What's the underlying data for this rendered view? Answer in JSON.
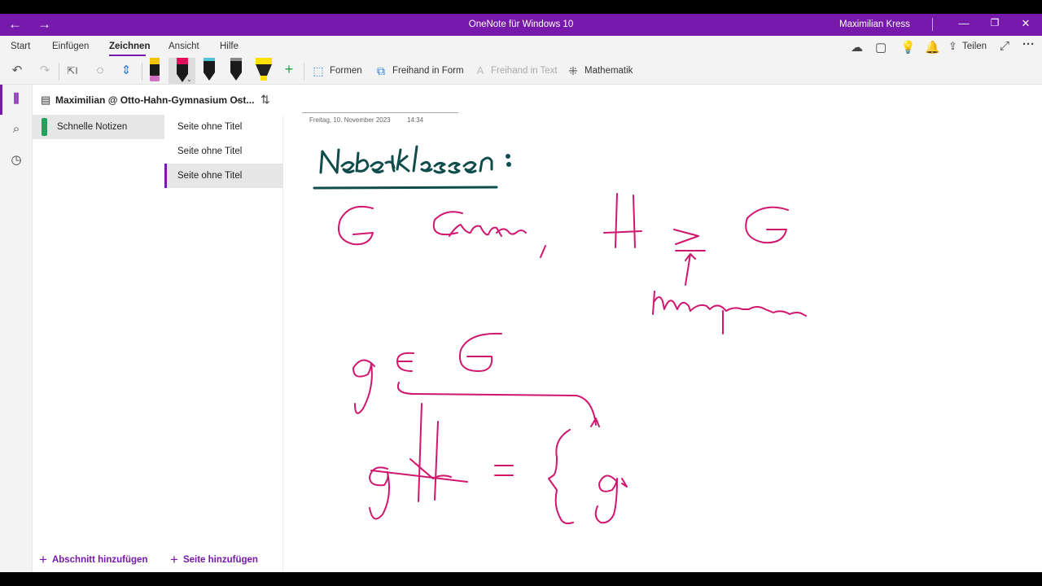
{
  "titlebar": {
    "app_title": "OneNote für Windows 10",
    "user": "Maximilian Kress"
  },
  "menu": {
    "tabs": [
      "Start",
      "Einfügen",
      "Zeichnen",
      "Ansicht",
      "Hilfe"
    ],
    "active_tab": "Zeichnen",
    "share_label": "Teilen"
  },
  "ribbon": {
    "shapes_label": "Formen",
    "ink_to_shape_label": "Freihand in Form",
    "ink_to_text_label": "Freihand in Text",
    "math_label": "Mathematik",
    "pens": [
      {
        "name": "pencil-pen",
        "color": "#1a1a1a",
        "accent": "#d070c0"
      },
      {
        "name": "pink-pen",
        "color": "#e0105a"
      },
      {
        "name": "black-pen",
        "color": "#1a1a1a",
        "accent": "#4fc3d8"
      },
      {
        "name": "dark-pen",
        "color": "#1a1a1a",
        "accent": "#888"
      },
      {
        "name": "highlighter",
        "color": "#ffe000"
      }
    ]
  },
  "notebook": {
    "name": "Maximilian @ Otto-Hahn-Gymnasium Ost...",
    "sections": [
      {
        "label": "Schnelle Notizen",
        "color": "#1fa35a"
      }
    ],
    "pages": [
      {
        "label": "Seite ohne Titel"
      },
      {
        "label": "Seite ohne Titel"
      },
      {
        "label": "Seite ohne Titel",
        "selected": true
      }
    ],
    "add_section_label": "Abschnitt hinzufügen",
    "add_page_label": "Seite hinzufügen"
  },
  "page": {
    "date": "Freitag, 10. November 2023",
    "time": "14:34",
    "ink_heading": "Nebenklassen:",
    "ink_lines": [
      "G Gruppe ,",
      "H ≤ G",
      "Untergruppe",
      "g ∈ G",
      "gH = {g"
    ]
  },
  "colors": {
    "accent": "#7719aa",
    "ink_pink": "#d0166e",
    "ink_teal": "#0f4d4d"
  }
}
